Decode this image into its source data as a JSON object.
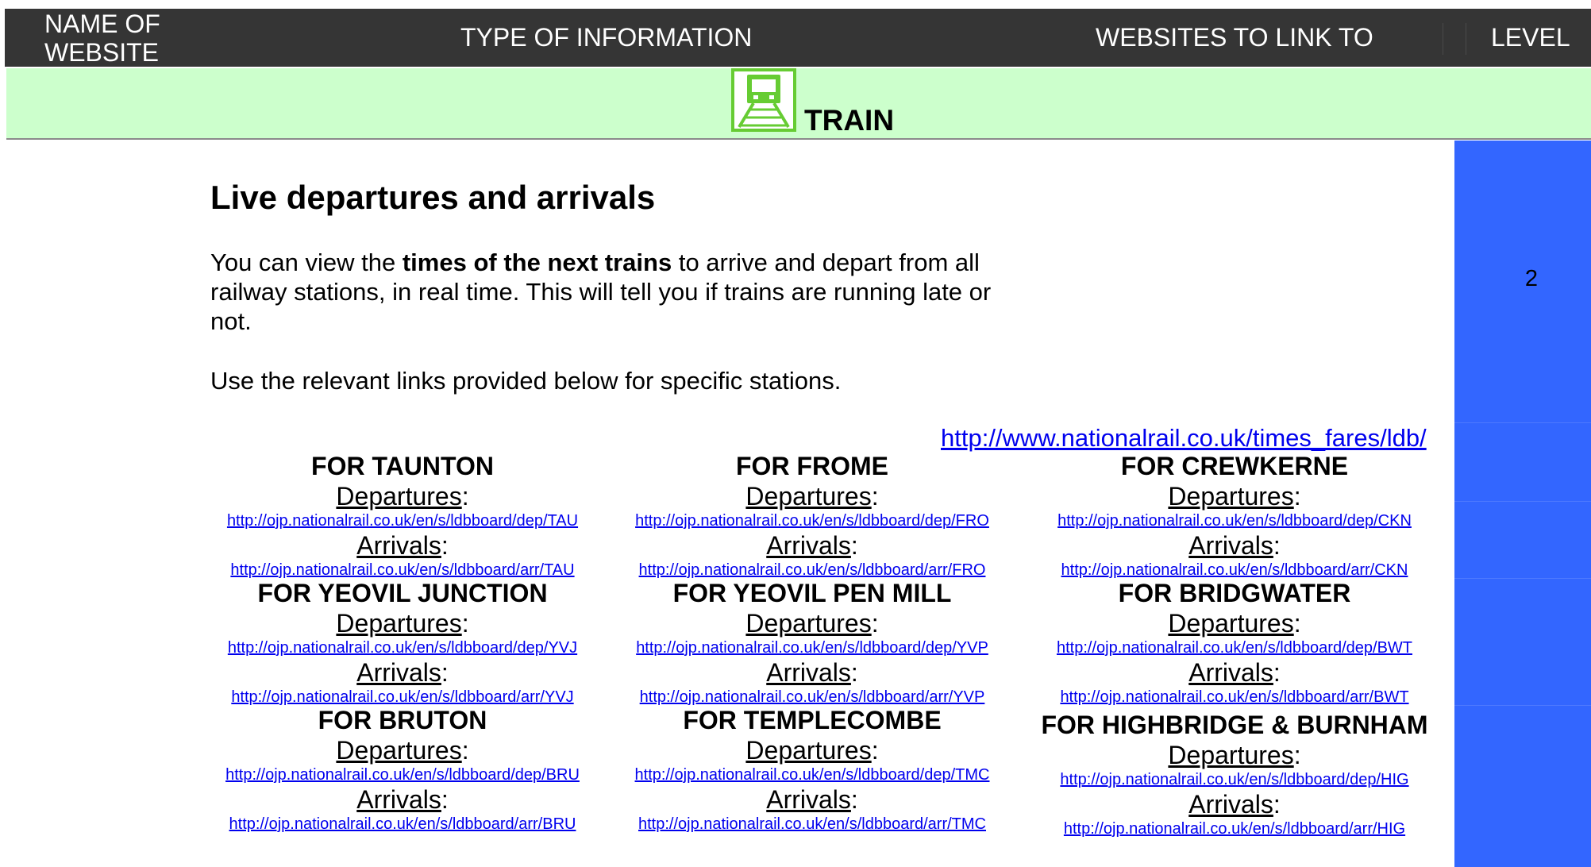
{
  "header": {
    "name_of_website": "NAME OF WEBSITE",
    "type_of_information": "TYPE OF INFORMATION",
    "websites_to_link_to": "WEBSITES TO LINK TO",
    "level": "LEVEL"
  },
  "category": {
    "icon": "train-icon",
    "label": "TRAIN",
    "band_color": "#ccffcc",
    "icon_color": "#66cc33"
  },
  "content": {
    "title": "Live departures and arrivals",
    "desc_part1": "You can view the ",
    "desc_bold": "times of the next trains",
    "desc_part2": " to arrive and depart from all railway stations, in real time. This will tell you if trains are running late or not.",
    "desc_line2": "Use the relevant links provided below for specific stations.",
    "main_link": "http://www.nationalrail.co.uk/times_fares/ldb/"
  },
  "labels": {
    "departures": "Departures",
    "arrivals": "Arrivals",
    "colon": ":"
  },
  "stations": [
    {
      "name": "FOR TAUNTON",
      "dep_url": "http://ojp.nationalrail.co.uk/en/s/ldbboard/dep/TAU",
      "arr_url": "http://ojp.nationalrail.co.uk/en/s/ldbboard/arr/TAU"
    },
    {
      "name": "FOR FROME",
      "dep_url": "http://ojp.nationalrail.co.uk/en/s/ldbboard/dep/FRO",
      "arr_url": "http://ojp.nationalrail.co.uk/en/s/ldbboard/arr/FRO"
    },
    {
      "name": "FOR CREWKERNE",
      "dep_url": "http://ojp.nationalrail.co.uk/en/s/ldbboard/dep/CKN",
      "arr_url": "http://ojp.nationalrail.co.uk/en/s/ldbboard/arr/CKN"
    },
    {
      "name": "FOR YEOVIL JUNCTION",
      "dep_url": "http://ojp.nationalrail.co.uk/en/s/ldbboard/dep/YVJ",
      "arr_url": "http://ojp.nationalrail.co.uk/en/s/ldbboard/arr/YVJ"
    },
    {
      "name": "FOR YEOVIL PEN MILL",
      "dep_url": "http://ojp.nationalrail.co.uk/en/s/ldbboard/dep/YVP",
      "arr_url": "http://ojp.nationalrail.co.uk/en/s/ldbboard/arr/YVP"
    },
    {
      "name": "FOR BRIDGWATER",
      "dep_url": "http://ojp.nationalrail.co.uk/en/s/ldbboard/dep/BWT",
      "arr_url": "http://ojp.nationalrail.co.uk/en/s/ldbboard/arr/BWT"
    },
    {
      "name": "FOR BRUTON",
      "dep_url": "http://ojp.nationalrail.co.uk/en/s/ldbboard/dep/BRU",
      "arr_url": "http://ojp.nationalrail.co.uk/en/s/ldbboard/arr/BRU"
    },
    {
      "name": "FOR TEMPLECOMBE",
      "dep_url": "http://ojp.nationalrail.co.uk/en/s/ldbboard/dep/TMC",
      "arr_url": "http://ojp.nationalrail.co.uk/en/s/ldbboard/arr/TMC"
    },
    {
      "name": "FOR HIGHBRIDGE & BURNHAM",
      "dep_url": "http://ojp.nationalrail.co.uk/en/s/ldbboard/dep/HIG",
      "arr_url": "http://ojp.nationalrail.co.uk/en/s/ldbboard/arr/HIG"
    }
  ],
  "level_value": "2",
  "level_color": "#3366ff"
}
